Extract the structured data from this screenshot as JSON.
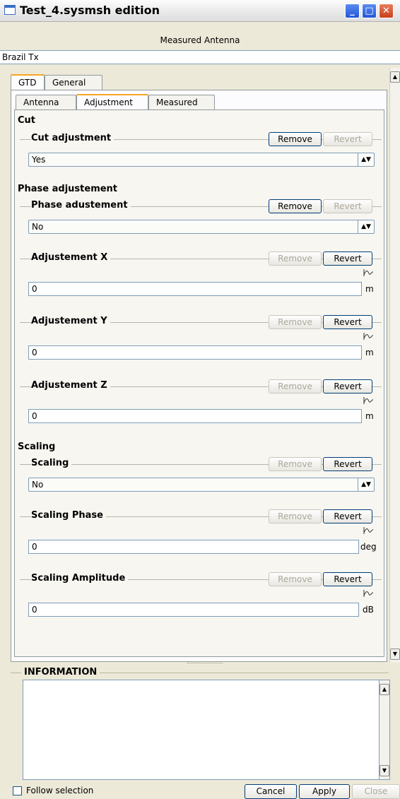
{
  "window": {
    "title": "Test_4.sysmsh edition"
  },
  "header": {
    "subtitle": "Measured Antenna",
    "name_value": "Brazil Tx"
  },
  "outer_tabs": [
    {
      "label": "GTD",
      "active": true
    },
    {
      "label": "General",
      "active": false
    }
  ],
  "inner_tabs": [
    {
      "label": "Antenna",
      "active": false
    },
    {
      "label": "Adjustment",
      "active": true
    },
    {
      "label": "Measured",
      "active": false
    }
  ],
  "sections": {
    "cut": "Cut",
    "phase": "Phase adjustement",
    "scaling": "Scaling"
  },
  "groups": {
    "cut_adjustment": {
      "title": "Cut adjustment",
      "value": "Yes"
    },
    "phase_adjustement": {
      "title": "Phase adustement",
      "value": "No"
    },
    "adj_x": {
      "title": "Adjustement X",
      "value": "0",
      "unit": "m"
    },
    "adj_y": {
      "title": "Adjustement Y",
      "value": "0",
      "unit": "m"
    },
    "adj_z": {
      "title": "Adjustement Z",
      "value": "0",
      "unit": "m"
    },
    "scaling": {
      "title": "Scaling",
      "value": "No"
    },
    "scaling_phase": {
      "title": "Scaling Phase",
      "value": "0",
      "unit": "deg"
    },
    "scaling_amplitude": {
      "title": "Scaling Amplitude",
      "value": "0",
      "unit": "dB"
    }
  },
  "buttons": {
    "remove": "Remove",
    "revert": "Revert"
  },
  "info": {
    "title": "INFORMATION"
  },
  "footer": {
    "follow_label": "Follow selection",
    "cancel": "Cancel",
    "apply": "Apply",
    "close": "Close"
  },
  "icons": {
    "window": "window-icon",
    "minimize": "minimize-icon",
    "maximize": "maximize-icon",
    "close": "close-icon",
    "curve": "curve-icon",
    "combo_arrow": "updown-arrow-icon"
  },
  "colors": {
    "title_close": "#c8401c",
    "tab_accent": "#f5a623",
    "field_border": "#7f9db9"
  }
}
